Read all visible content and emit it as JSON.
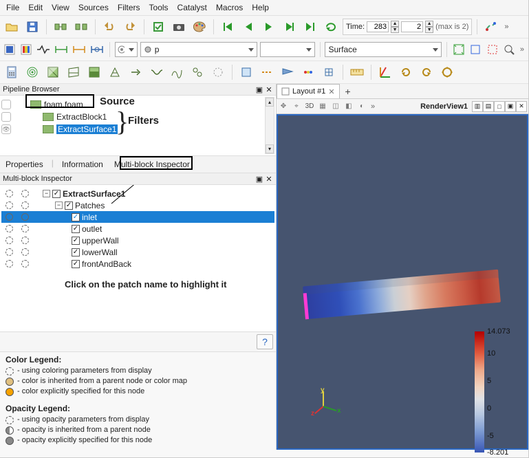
{
  "menu": {
    "items": [
      "File",
      "Edit",
      "View",
      "Sources",
      "Filters",
      "Tools",
      "Catalyst",
      "Macros",
      "Help"
    ]
  },
  "time": {
    "label": "Time:",
    "frame": "283",
    "step": "2",
    "max_label": "(max is 2)"
  },
  "field_dropdown": {
    "value": "p"
  },
  "repr_dropdown": {
    "value": "Surface"
  },
  "pipeline": {
    "title": "Pipeline Browser",
    "rows": [
      {
        "name": "foam.foam",
        "indent": 0,
        "active": false
      },
      {
        "name": "ExtractBlock1",
        "indent": 1,
        "active": false
      },
      {
        "name": "ExtractSurface1",
        "indent": 1,
        "active": true
      }
    ]
  },
  "annotations": {
    "source": "Source",
    "filters": "Filters",
    "hint": "Click on the patch name to highlight it"
  },
  "prop_tabs": {
    "properties": "Properties",
    "information": "Information",
    "mbi": "Multi-block Inspector"
  },
  "mbi": {
    "title": "Multi-block Inspector",
    "root": "ExtractSurface1",
    "group": "Patches",
    "patches": [
      "inlet",
      "outlet",
      "upperWall",
      "lowerWall",
      "frontAndBack"
    ],
    "selected": "inlet"
  },
  "color_legend": {
    "title": "Color Legend:",
    "rows": [
      "- using coloring parameters from display",
      "- color is inherited from a parent node or color map",
      "- color explicitly specified for this node"
    ]
  },
  "opacity_legend": {
    "title": "Opacity Legend:",
    "rows": [
      "- using opacity parameters from display",
      "- opacity is inherited from a parent node",
      "- opacity explicitly specified for this node"
    ]
  },
  "layout": {
    "tab": "Layout #1",
    "render_view": "RenderView1"
  },
  "chart_data": {
    "type": "colorbar",
    "variable": "p",
    "ticks": [
      14.073,
      10,
      5,
      0,
      -5,
      -8.201
    ],
    "range": [
      -8.201,
      14.073
    ]
  }
}
